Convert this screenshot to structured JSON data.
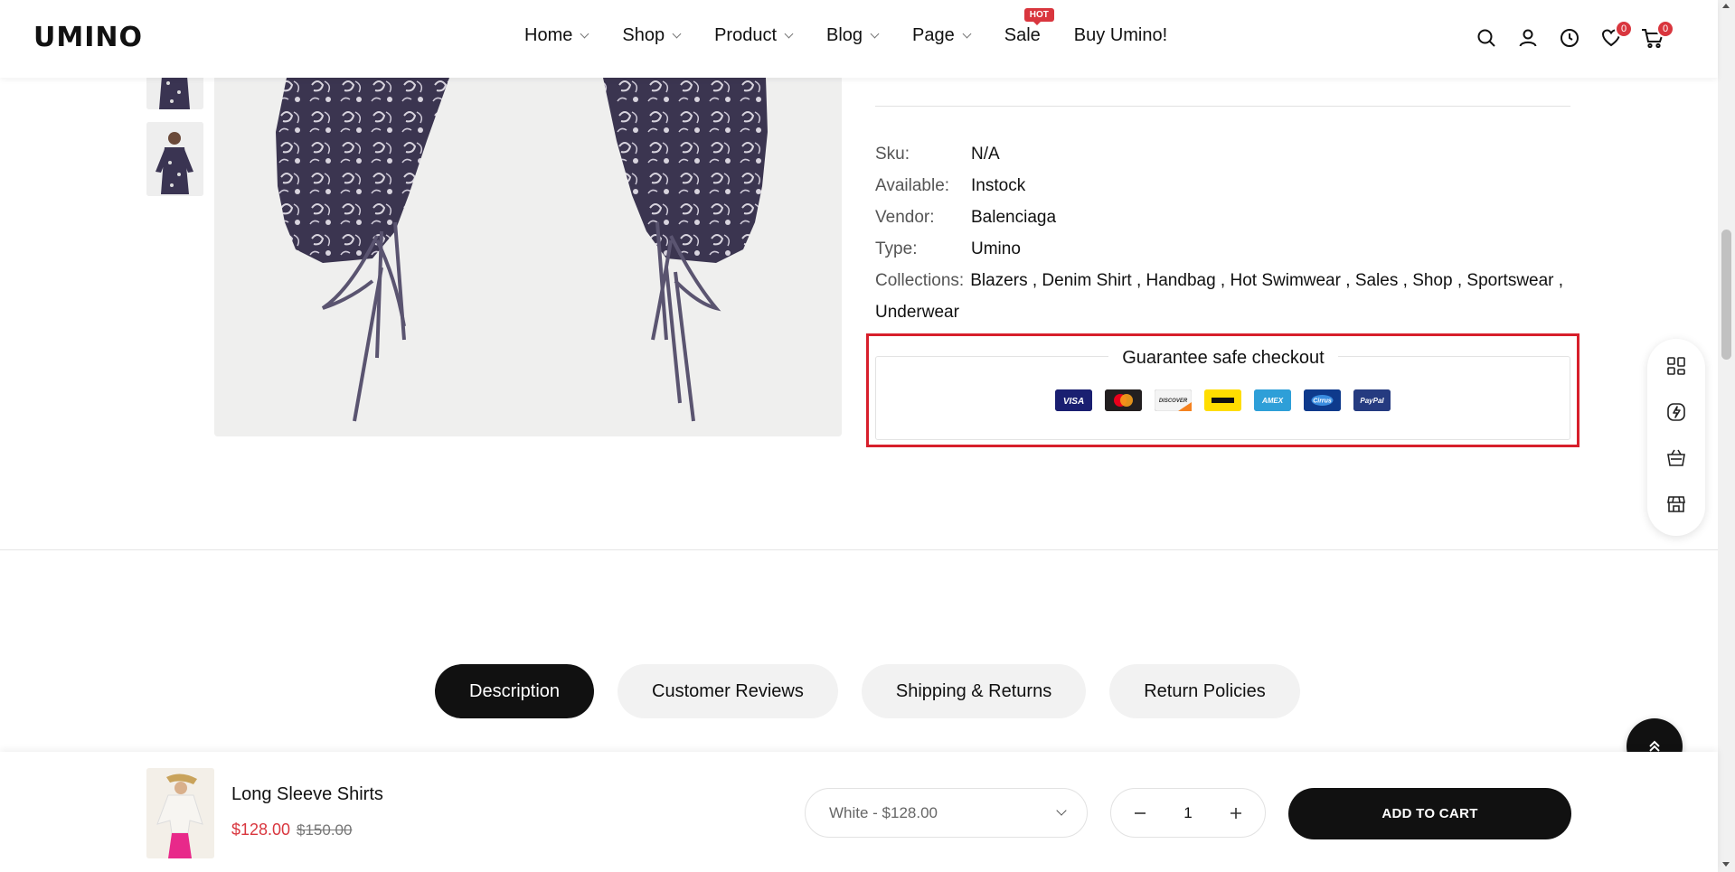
{
  "header": {
    "logo": "UMINO",
    "nav": [
      {
        "label": "Home"
      },
      {
        "label": "Shop"
      },
      {
        "label": "Product"
      },
      {
        "label": "Blog"
      },
      {
        "label": "Page"
      }
    ],
    "sale_label": "Sale",
    "hot_badge": "HOT",
    "buy_label": "Buy Umino!",
    "wishlist_count": "0",
    "cart_count": "0",
    "icons": [
      "search-icon",
      "user-icon",
      "clock-icon",
      "heart-icon",
      "cart-icon"
    ]
  },
  "product": {
    "sku_label": "Sku:",
    "sku": "N/A",
    "available_label": "Available:",
    "available": "Instock",
    "vendor_label": "Vendor:",
    "vendor": "Balenciaga",
    "type_label": "Type:",
    "type": "Umino",
    "collections_label": "Collections:",
    "collections": [
      "Blazers",
      "Denim Shirt",
      "Handbag",
      "Hot Swimwear",
      "Sales",
      "Shop",
      "Sportswear",
      "Underwear"
    ]
  },
  "guarantee": {
    "title": "Guarantee safe checkout",
    "cards": [
      {
        "name": "VISA",
        "color": "#1a1f71"
      },
      {
        "name": "MasterCard",
        "color": "#231f20"
      },
      {
        "name": "DISCOVER",
        "color": "#f2f2f2"
      },
      {
        "name": "Western Union",
        "color": "#ffdd00"
      },
      {
        "name": "AMEX",
        "color": "#2e9fd8"
      },
      {
        "name": "Cirrus",
        "color": "#0e3a8c"
      },
      {
        "name": "PayPal",
        "color": "#253b80"
      }
    ]
  },
  "tabs": [
    {
      "label": "Description",
      "active": true
    },
    {
      "label": "Customer Reviews",
      "active": false
    },
    {
      "label": "Shipping & Returns",
      "active": false
    },
    {
      "label": "Return Policies",
      "active": false
    }
  ],
  "sticky": {
    "name": "Long Sleeve Shirts",
    "price": "$128.00",
    "old_price": "$150.00",
    "variant": "White - $128.00",
    "quantity": "1",
    "add_to_cart": "ADD TO CART"
  },
  "colors": {
    "accent": "#d9363e",
    "highlight_border": "#d71f2b",
    "dark": "#111111"
  }
}
